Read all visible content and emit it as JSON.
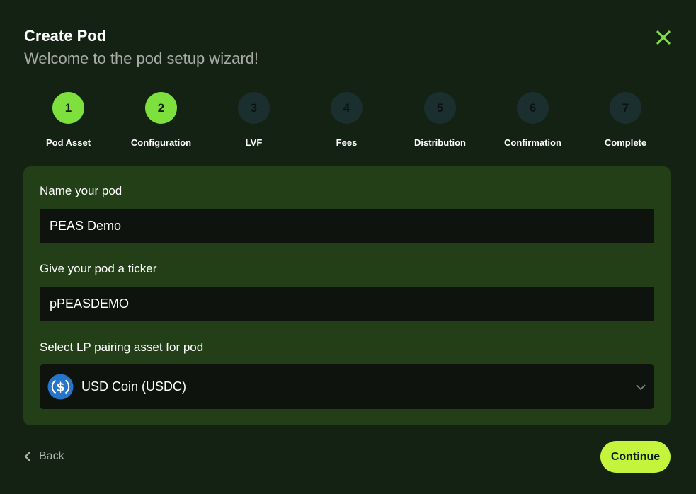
{
  "header": {
    "title": "Create Pod",
    "subtitle": "Welcome to the pod setup wizard!",
    "close_icon": "close-icon"
  },
  "stepper": {
    "current_step": 2,
    "steps": [
      {
        "number": "1",
        "label": "Pod Asset",
        "state": "done"
      },
      {
        "number": "2",
        "label": "Configuration",
        "state": "active"
      },
      {
        "number": "3",
        "label": "LVF",
        "state": "pending"
      },
      {
        "number": "4",
        "label": "Fees",
        "state": "pending"
      },
      {
        "number": "5",
        "label": "Distribution",
        "state": "pending"
      },
      {
        "number": "6",
        "label": "Confirmation",
        "state": "pending"
      },
      {
        "number": "7",
        "label": "Complete",
        "state": "pending"
      }
    ]
  },
  "form": {
    "name": {
      "label": "Name your pod",
      "value": "PEAS Demo"
    },
    "ticker": {
      "label": "Give your pod a ticker",
      "value": "pPEASDEMO"
    },
    "pairing": {
      "label": "Select LP pairing asset for pod",
      "selected": "USD Coin (USDC)",
      "icon": "usdc-coin-icon"
    }
  },
  "footer": {
    "back_label": "Back",
    "continue_label": "Continue"
  },
  "colors": {
    "background": "#142214",
    "panel": "#233f17",
    "input": "#0e140d",
    "accent_green": "#7ee03c",
    "continue_button": "#c4f43c",
    "pending_step": "#1b2f2f",
    "usdc_blue": "#2775ca"
  }
}
